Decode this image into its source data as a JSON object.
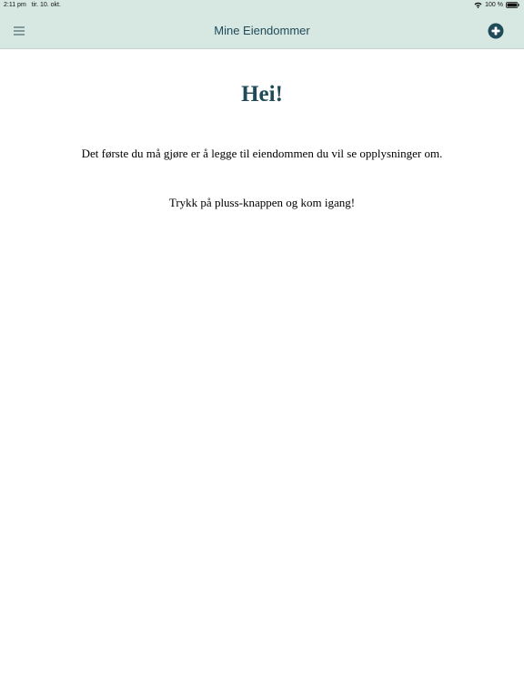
{
  "status_bar": {
    "time": "2:11 pm",
    "date": "tir. 10. okt.",
    "battery_percent": "100 %",
    "wifi_icon": "wifi-icon",
    "battery_icon": "battery-full-icon"
  },
  "header": {
    "title": "Mine Eiendommer",
    "menu_icon": "hamburger-menu-icon",
    "add_icon": "plus-circle-icon",
    "background_color": "#d7e8e3",
    "accent_color": "#1f4a58"
  },
  "main": {
    "greeting": "Hei!",
    "intro": "Det første du må gjøre er å legge til eiendommen du vil se opplysninger om.",
    "cta": "Trykk på pluss-knappen og kom igang!"
  }
}
